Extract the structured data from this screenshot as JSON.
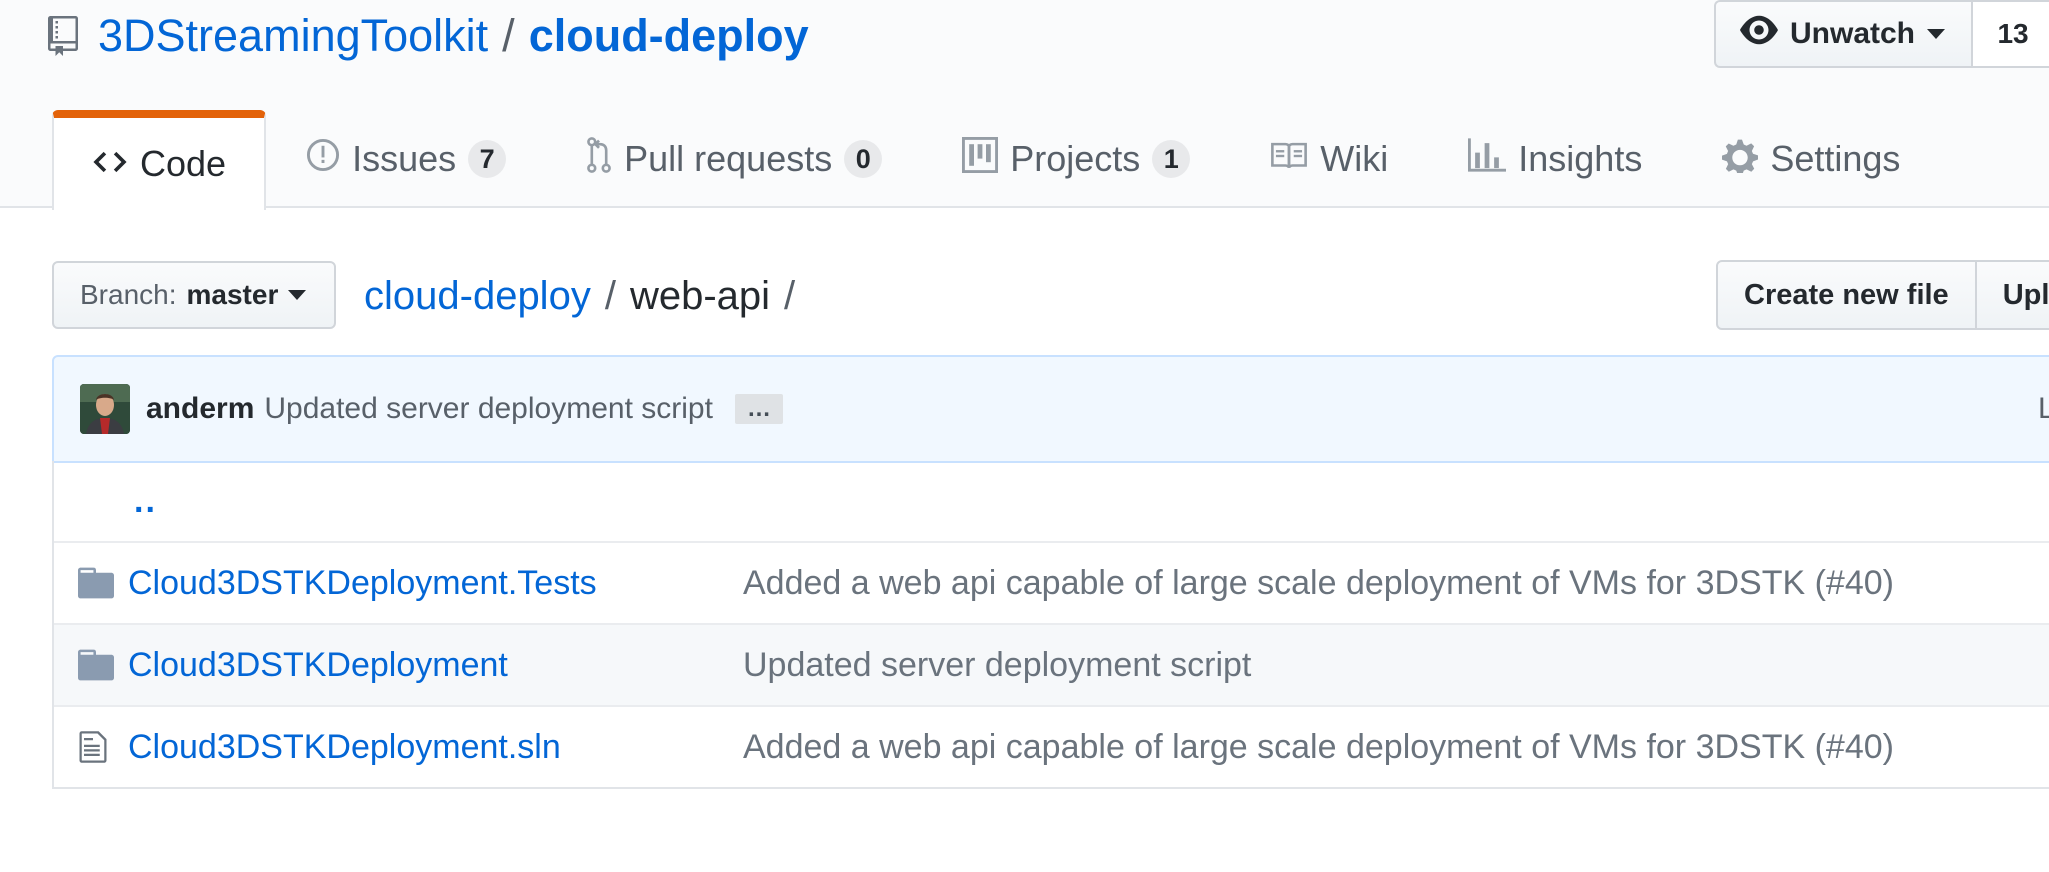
{
  "repo": {
    "owner": "3DStreamingToolkit",
    "separator": "/",
    "name": "cloud-deploy"
  },
  "watch": {
    "label": "Unwatch",
    "count": "13"
  },
  "tabs": [
    {
      "label": "Code",
      "icon": "code-icon",
      "selected": true
    },
    {
      "label": "Issues",
      "count": "7",
      "icon": "issue-opened-icon"
    },
    {
      "label": "Pull requests",
      "count": "0",
      "icon": "git-pull-request-icon"
    },
    {
      "label": "Projects",
      "count": "1",
      "icon": "project-icon"
    },
    {
      "label": "Wiki",
      "icon": "book-icon"
    },
    {
      "label": "Insights",
      "icon": "graph-icon"
    },
    {
      "label": "Settings",
      "icon": "gear-icon"
    }
  ],
  "branch": {
    "prefix": "Branch:",
    "name": "master"
  },
  "breadcrumb": {
    "root": "cloud-deploy",
    "sep1": "/",
    "current": "web-api",
    "sep2": "/"
  },
  "file_actions": {
    "create": "Create new file",
    "upload": "Upl"
  },
  "commit": {
    "author": "anderm",
    "message": "Updated server deployment script",
    "ellipsis": "…",
    "latest": "Lates"
  },
  "files": {
    "updir": "..",
    "rows": [
      {
        "name": "Cloud3DSTKDeployment.Tests",
        "type": "directory",
        "icon": "file-directory-icon",
        "message": "Added a web api capable of large scale deployment of VMs for 3DSTK (#40)"
      },
      {
        "name": "Cloud3DSTKDeployment",
        "type": "directory",
        "icon": "file-directory-icon",
        "message": "Updated server deployment script"
      },
      {
        "name": "Cloud3DSTKDeployment.sln",
        "type": "file",
        "icon": "file-icon",
        "message": "Added a web api capable of large scale deployment of VMs for 3DSTK (#40)"
      }
    ]
  },
  "colors": {
    "link": "#0366d6",
    "selected_tab_accent": "#e36209",
    "commit_bg": "#f1f8ff"
  }
}
